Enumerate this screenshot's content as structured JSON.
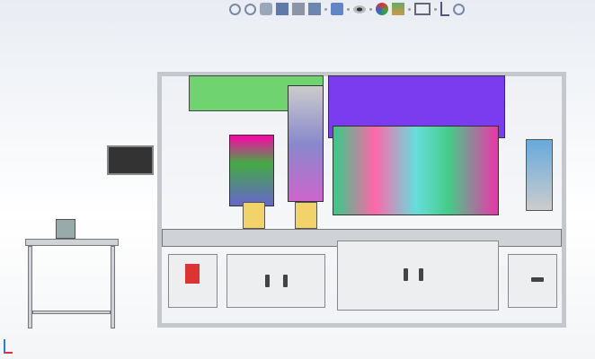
{
  "toolbar": {
    "icons": [
      "zoom-to-fit-icon",
      "zoom-area-icon",
      "previous-view-icon",
      "section-view-icon",
      "dynamic-annotation-icon",
      "view-orientation-icon",
      "display-style-icon",
      "hide-show-icon",
      "edit-appearance-icon",
      "apply-scene-icon",
      "view-settings-icon",
      "triad-icon",
      "zoom-sheet-icon"
    ]
  },
  "colors": {
    "green": "#6fd46f",
    "purple": "#7b3cf0",
    "yellow": "#f2d36a",
    "frame": "#cfd2d6"
  }
}
